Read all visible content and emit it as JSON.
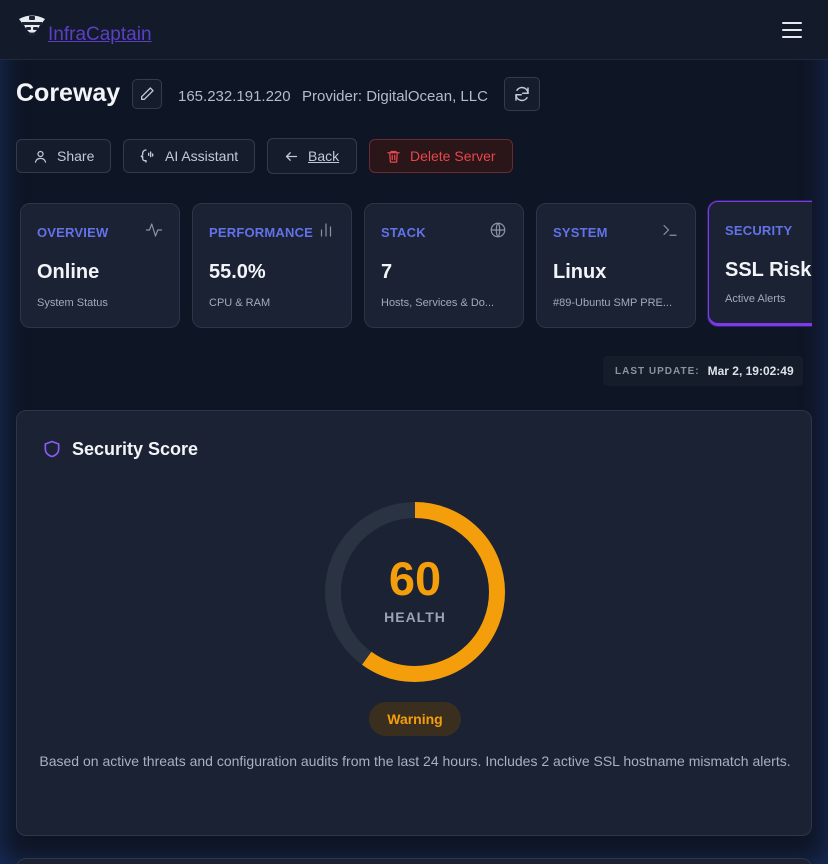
{
  "app": {
    "brand": "InfraCaptain"
  },
  "server": {
    "name": "Coreway",
    "ip": "165.232.191.220",
    "provider": "Provider: DigitalOcean, LLC"
  },
  "actions": {
    "share": "Share",
    "ai": "AI Assistant",
    "back": "Back",
    "delete": "Delete Server"
  },
  "cards": [
    {
      "label": "OVERVIEW",
      "value": "Online",
      "sub": "System Status",
      "icon": "activity-icon"
    },
    {
      "label": "PERFORMANCE",
      "value": "55.0%",
      "sub": "CPU & RAM",
      "icon": "bar-chart-icon"
    },
    {
      "label": "STACK",
      "value": "7",
      "sub": "Hosts, Services & Do...",
      "icon": "globe-icon"
    },
    {
      "label": "SYSTEM",
      "value": "Linux",
      "sub": "#89-Ubuntu SMP PRE...",
      "icon": "terminal-icon"
    },
    {
      "label": "SECURITY",
      "value": "SSL Risk",
      "sub": "Active Alerts",
      "icon": "shield-icon"
    }
  ],
  "last_update": {
    "label": "LAST UPDATE:",
    "value": "Mar 2, 19:02:49"
  },
  "security": {
    "title": "Security Score",
    "score": "60",
    "score_fraction": 0.6,
    "score_label": "HEALTH",
    "status": "Warning",
    "description": "Based on active threats and configuration audits from the last 24 hours. Includes 2 active SSL hostname mismatch alerts."
  },
  "colors": {
    "accent": "#6272e8",
    "security_accent": "#7c3aed",
    "warning": "#f59e0b",
    "danger": "#e5484d",
    "track": "#2a3342"
  }
}
